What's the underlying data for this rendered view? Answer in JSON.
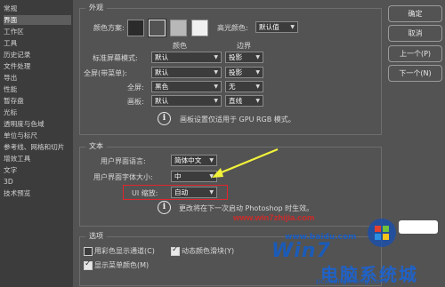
{
  "nav": {
    "items": [
      {
        "label": "常规",
        "active": false
      },
      {
        "label": "界面",
        "active": true
      },
      {
        "label": "工作区",
        "active": false
      },
      {
        "label": "工具",
        "active": false
      },
      {
        "label": "历史记录",
        "active": false
      },
      {
        "label": "文件处理",
        "active": false
      },
      {
        "label": "导出",
        "active": false
      },
      {
        "label": "性能",
        "active": false
      },
      {
        "label": "暂存盘",
        "active": false
      },
      {
        "label": "光标",
        "active": false
      },
      {
        "label": "透明度与色域",
        "active": false
      },
      {
        "label": "单位与标尺",
        "active": false
      },
      {
        "label": "参考线、网格和切片",
        "active": false
      },
      {
        "label": "增效工具",
        "active": false
      },
      {
        "label": "文字",
        "active": false
      },
      {
        "label": "3D",
        "active": false
      },
      {
        "label": "技术预览",
        "active": false
      }
    ]
  },
  "buttons": {
    "ok": "确定",
    "cancel": "取消",
    "prev": "上一个(P)",
    "next": "下一个(N)"
  },
  "appearance": {
    "legend": "外观",
    "color_scheme_label": "颜色方案:",
    "swatch_colors": [
      "#2b2b2b",
      "#535353",
      "#b8b8b8",
      "#f0f0f0"
    ],
    "highlight_color_label": "高光颜色:",
    "highlight_color_value": "默认值",
    "col_color": "颜色",
    "col_border": "边界",
    "rows": [
      {
        "label": "标准屏幕模式:",
        "color": "默认",
        "border": "投影"
      },
      {
        "label": "全屏(带菜单):",
        "color": "默认",
        "border": "投影"
      },
      {
        "label": "全屏:",
        "color": "黑色",
        "border": "无"
      },
      {
        "label": "画板:",
        "color": "默认",
        "border": "直线"
      }
    ],
    "note": "画板设置仅适用于 GPU RGB 模式。"
  },
  "text": {
    "legend": "文本",
    "ui_language_label": "用户界面语言:",
    "ui_language_value": "简体中文",
    "ui_font_size_label": "用户界面字体大小:",
    "ui_font_size_value": "中",
    "ui_scale_label": "UI 缩放:",
    "ui_scale_value": "自动",
    "note": "更改将在下一次启动 Photoshop 时生效。"
  },
  "options": {
    "legend": "选项",
    "items": [
      {
        "label": "用彩色显示通道(C)",
        "checked": false
      },
      {
        "label": "动态颜色滑块(Y)",
        "checked": true
      },
      {
        "label": "显示菜单颜色(M)",
        "checked": true
      }
    ]
  },
  "watermark": {
    "url": "www.win7zhijia.com",
    "big": "Win7",
    "sub": "www.baidu.com",
    "brand": "电脑系统城",
    "sub2": "pcxitongcheng.com"
  },
  "colors": {
    "arrow": "#f2f23a",
    "highlight_box": "#e0262c"
  }
}
